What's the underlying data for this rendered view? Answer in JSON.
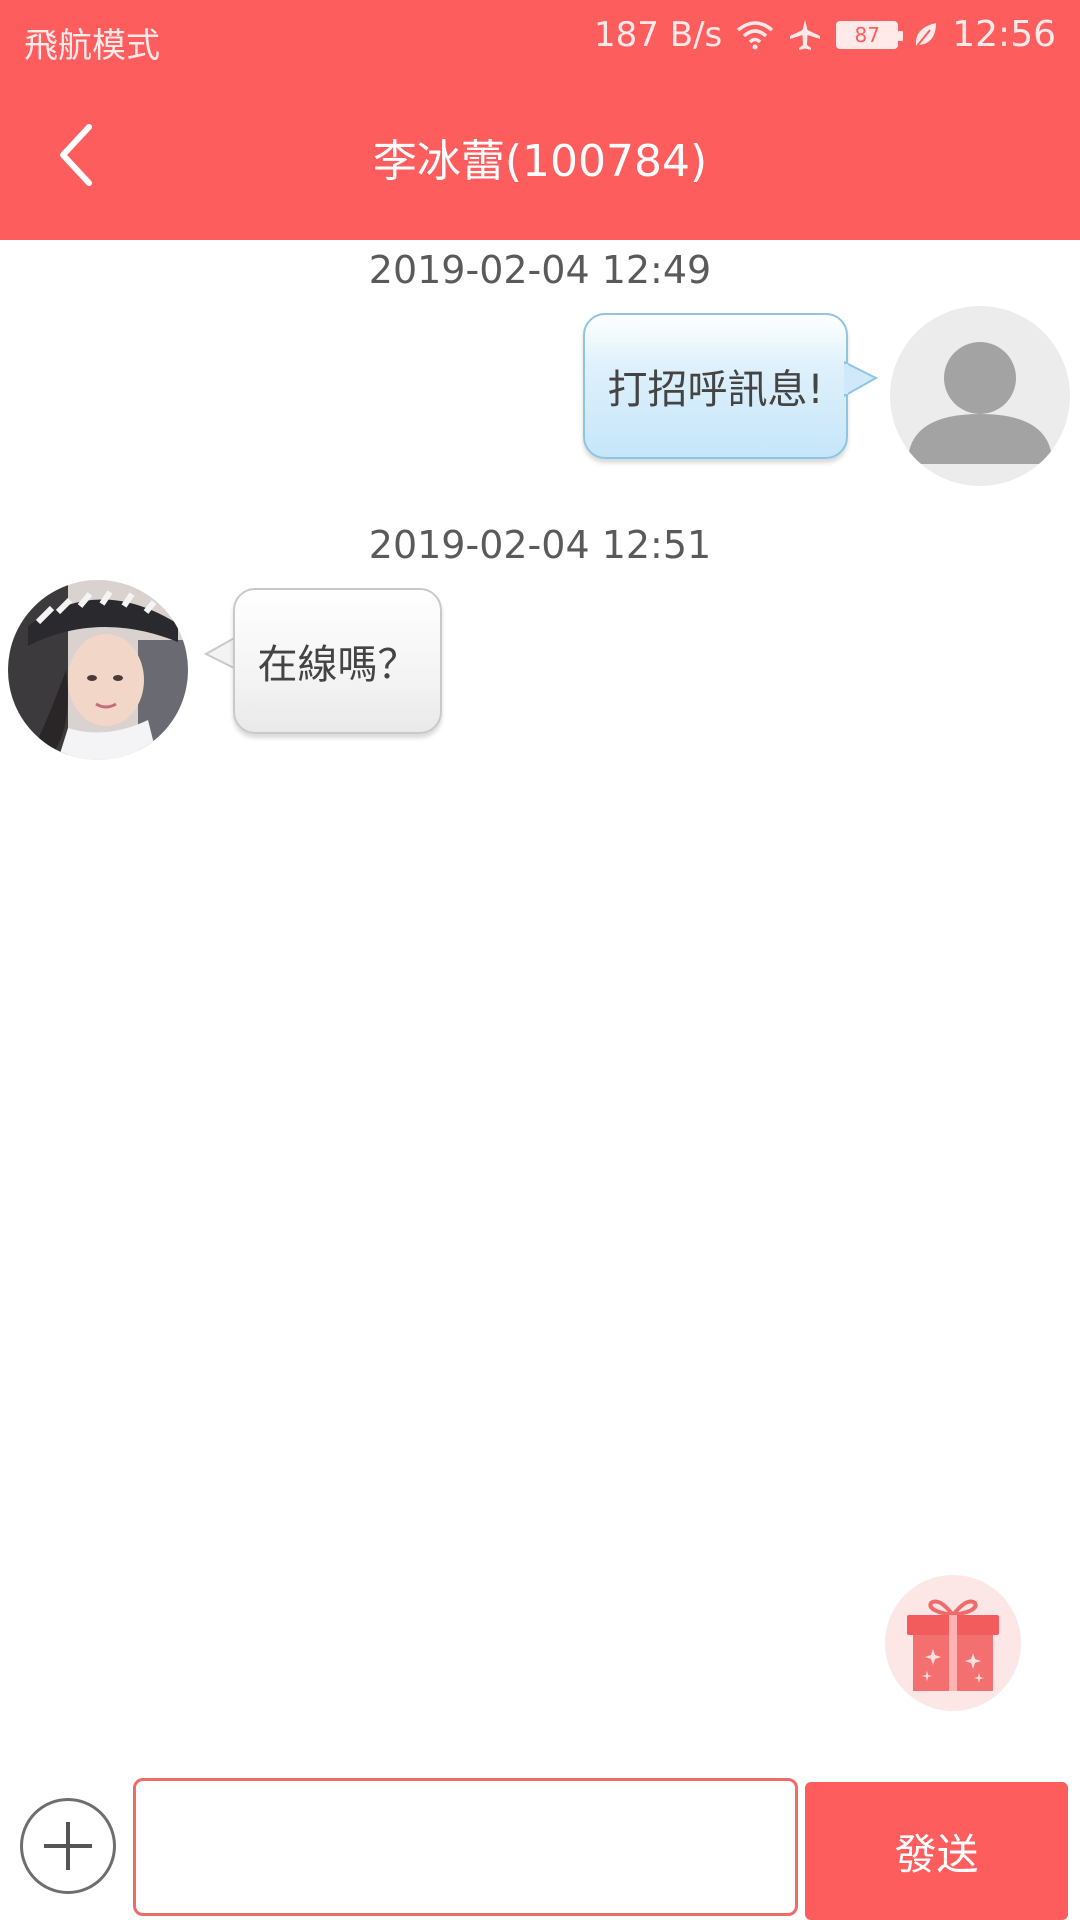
{
  "status_bar": {
    "carrier": "飛航模式",
    "net_speed": "187 B/s",
    "battery": "87",
    "time": "12:56",
    "icons": [
      "wifi-icon",
      "airplane-icon",
      "battery-icon",
      "leaf-icon"
    ]
  },
  "header": {
    "title": "李冰蕾(100784)",
    "back_icon": "chevron-left-icon"
  },
  "messages": [
    {
      "timestamp": "2019-02-04 12:49",
      "direction": "outgoing",
      "text": "打招呼訊息!",
      "avatar": "default-avatar"
    },
    {
      "timestamp": "2019-02-04 12:51",
      "direction": "incoming",
      "text": "在線嗎？",
      "avatar": "user-photo"
    }
  ],
  "gift": {
    "icon": "gift-icon"
  },
  "composer": {
    "plus_icon": "plus-icon",
    "input_value": "",
    "send_label": "發送"
  },
  "colors": {
    "brand": "#fd5d5d",
    "outgoing_bubble": "#c6e6fa",
    "incoming_bubble": "#eeeeee"
  }
}
